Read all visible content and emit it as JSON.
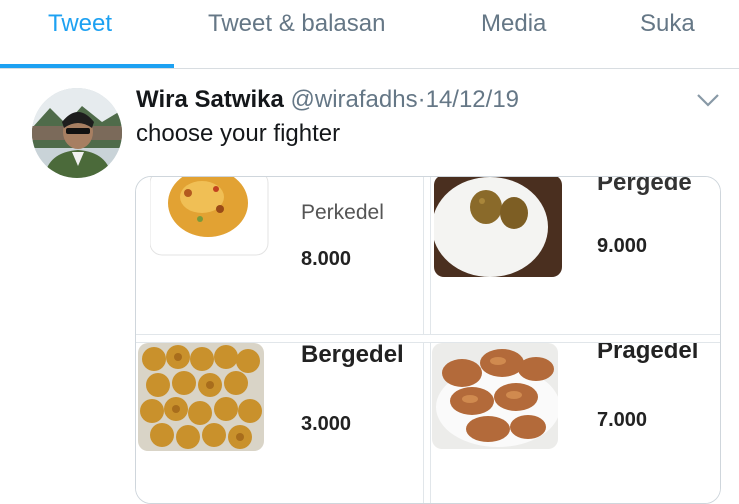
{
  "tabs": [
    {
      "label": "Tweet",
      "active": true
    },
    {
      "label": "Tweet & balasan",
      "active": false
    },
    {
      "label": "Media",
      "active": false
    },
    {
      "label": "Suka",
      "active": false
    }
  ],
  "tweet": {
    "name": "Wira Satwika",
    "handle": "@wirafadhs",
    "separator": "·",
    "date": "14/12/19",
    "text": "choose your fighter"
  },
  "media": {
    "items": [
      {
        "name": "Perkedel",
        "price": "8.000"
      },
      {
        "name": "Pergede",
        "price": "9.000"
      },
      {
        "name": "Bergedel",
        "price": "3.000"
      },
      {
        "name": "Pragedel",
        "price": "7.000"
      }
    ]
  },
  "colors": {
    "accent": "#1da1f2",
    "muted": "#657786",
    "border": "#d8dde1"
  },
  "icons": {
    "menu": "chevron-down-icon"
  }
}
